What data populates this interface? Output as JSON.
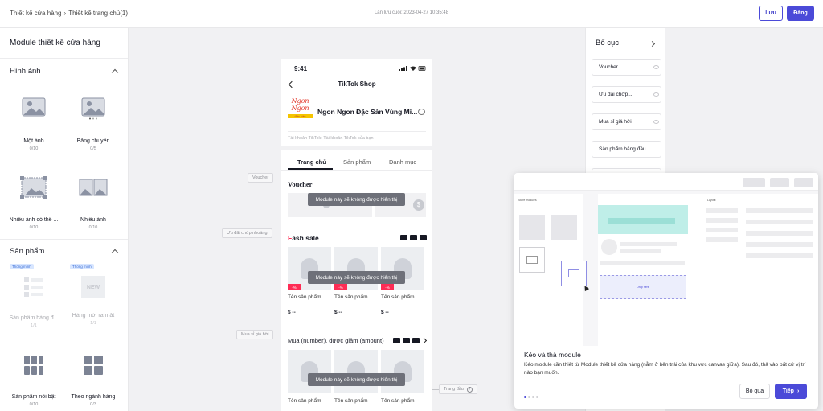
{
  "header": {
    "breadcrumb_root": "Thiết kế cửa hàng",
    "breadcrumb_current": "Thiết kế trang chủ(1)",
    "last_saved": "Lần lưu cuối: 2023-04-27 10:35:48",
    "save_label": "Lưu",
    "post_label": "Đăng"
  },
  "left": {
    "title": "Module thiết kế cửa hàng",
    "sections": [
      {
        "title": "Hình ảnh",
        "items": [
          {
            "label": "Một ảnh",
            "count": "0/10"
          },
          {
            "label": "Băng chuyền",
            "count": "0/5"
          },
          {
            "label": "Nhiều ảnh có thể ...",
            "count": "0/10"
          },
          {
            "label": "Nhiều ảnh",
            "count": "0/10"
          }
        ]
      },
      {
        "title": "Sản phẩm",
        "items": [
          {
            "label": "Sản phẩm hàng đ...",
            "count": "1/1",
            "tag": "Thông minh"
          },
          {
            "label": "Hàng mới ra mắt",
            "count": "1/1",
            "tag": "Thông minh",
            "badge": "NEW"
          },
          {
            "label": "Sản phẩm nổi bật",
            "count": "0/10"
          },
          {
            "label": "Theo ngành hàng",
            "count": "0/3"
          }
        ]
      }
    ]
  },
  "canvas": {
    "labels": [
      "Voucher",
      "Ưu đãi chớp nhoáng",
      "Mua sỉ giá hời",
      "Trang đầu"
    ]
  },
  "phone": {
    "time": "9:41",
    "title": "TikTok Shop",
    "shop_name": "Ngon Ngon Đặc Sản Vùng Mi...",
    "logo_text": "Ngon Ngon",
    "logo_sub": "đặc sản",
    "account": "Tài khoản TikTok: Tài khoản TikTok của bạn",
    "tabs": [
      "Trang chủ",
      "Sản phẩm",
      "Danh mục"
    ],
    "voucher_title": "Voucher",
    "hidden_msg": "Module này sẽ không được hiển thị",
    "flash_title_f": "F",
    "flash_title_rest": "ash sale",
    "bulk_title": "Mua (number), được giảm (amount)",
    "product_name": "Tên sản phẩm",
    "price": "$ --",
    "discount": "-%"
  },
  "layout_panel": {
    "title": "Bố cục",
    "items": [
      "Voucher",
      "Ưu đãi chớp...",
      "Mua sỉ giá hời",
      "Sản phẩm hàng đầu"
    ]
  },
  "tour": {
    "title": "Kéo và thả module",
    "desc": "Kéo module cần thiết từ Module thiết kế cửa hàng (nằm ở bên trái của khu vực canvas giữa). Sau đó, thả vào bất cứ vị trí nào bạn muốn.",
    "skip_label": "Bỏ qua",
    "next_label": "Tiếp",
    "demo_left_title": "Store modules",
    "demo_right_title": "Layout",
    "demo_drop_text": "Drop here"
  },
  "colors": {
    "accent": "#4b4ad8",
    "flash_red": "#fe2c55"
  }
}
